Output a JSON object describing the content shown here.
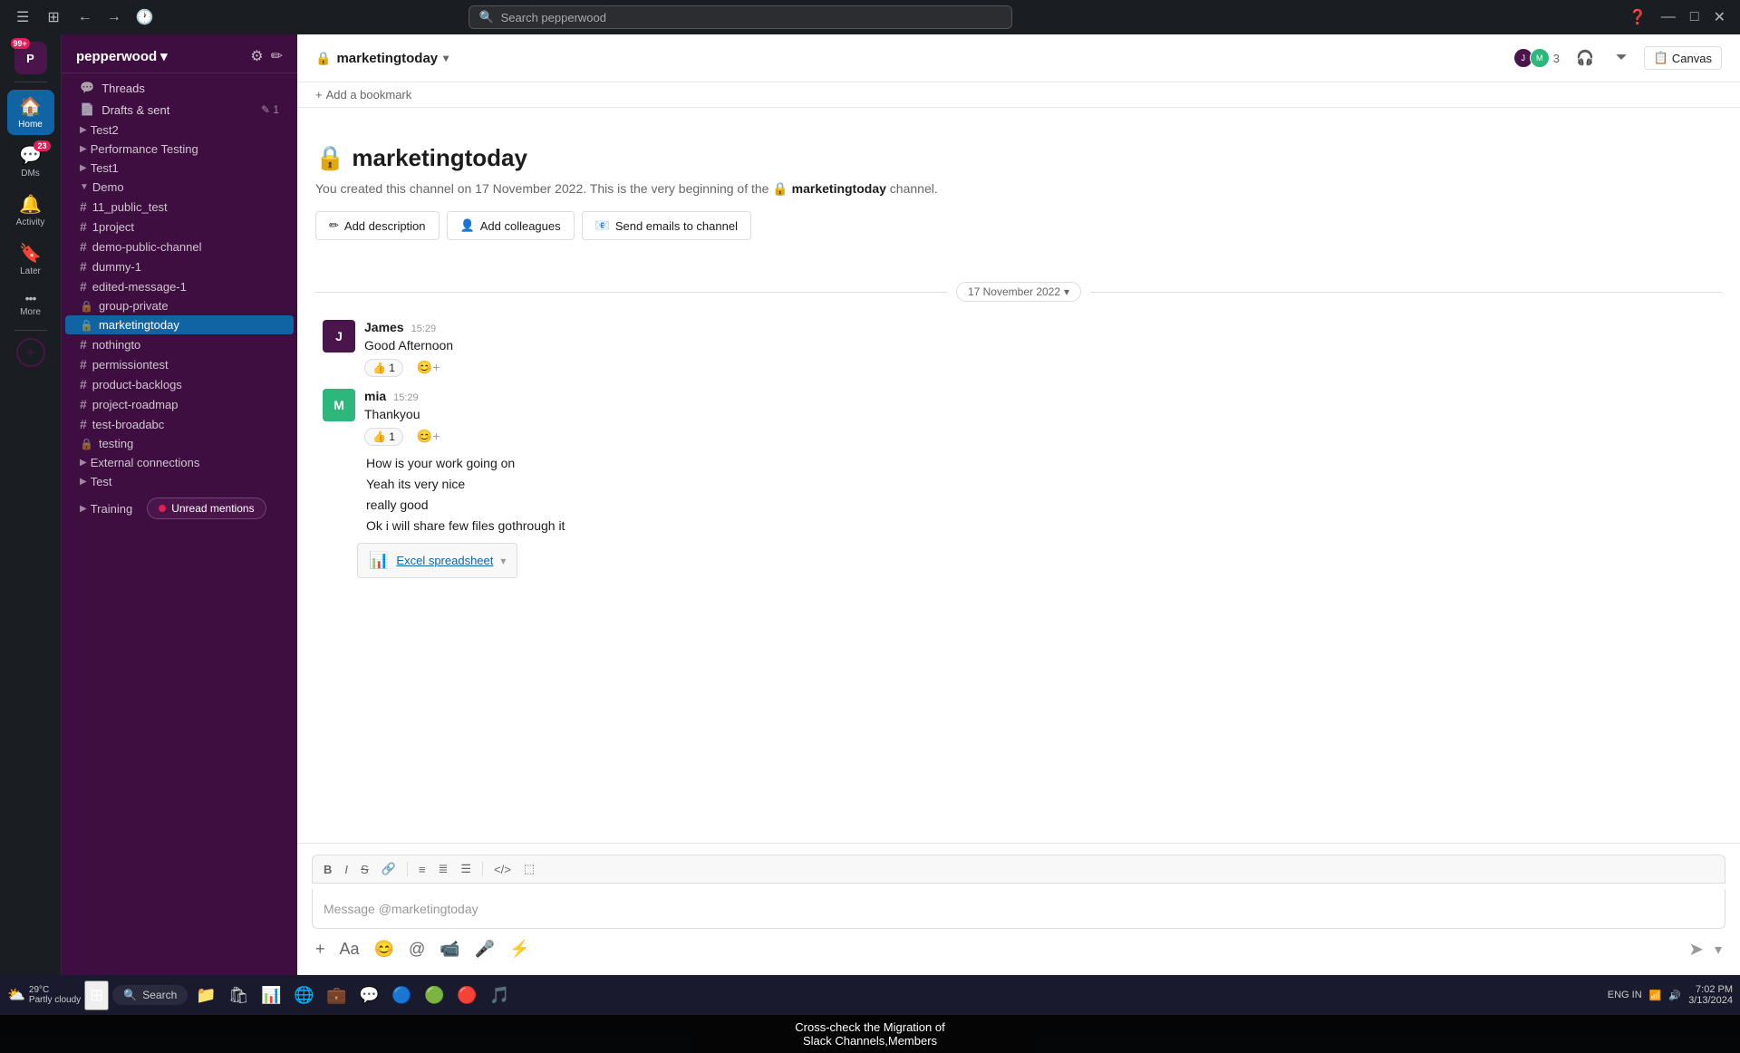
{
  "titlebar": {
    "search_placeholder": "Search pepperwood",
    "window_controls": {
      "minimize": "—",
      "maximize": "□",
      "close": "✕"
    }
  },
  "sidebar": {
    "workspace": "pepperwood",
    "items": [
      {
        "id": "threads",
        "label": "Threads",
        "icon": "💬",
        "type": "nav"
      },
      {
        "id": "drafts",
        "label": "Drafts & sent",
        "icon": "📄",
        "badge": "1",
        "type": "nav"
      },
      {
        "id": "test2",
        "label": "Test2",
        "type": "channel-group",
        "chevron": "▶"
      },
      {
        "id": "performance-testing",
        "label": "Performance Testing",
        "type": "channel-group",
        "chevron": "▶"
      },
      {
        "id": "test1",
        "label": "Test1",
        "type": "channel-group",
        "chevron": "▶"
      },
      {
        "id": "demo",
        "label": "Demo",
        "type": "channel-group",
        "chevron": "▼"
      },
      {
        "id": "11_public_test",
        "label": "11_public_test",
        "type": "public-channel"
      },
      {
        "id": "1project",
        "label": "1project",
        "type": "public-channel"
      },
      {
        "id": "demo-public-channel",
        "label": "demo-public-channel",
        "type": "public-channel"
      },
      {
        "id": "dummy-1",
        "label": "dummy-1",
        "type": "public-channel"
      },
      {
        "id": "edited-message-1",
        "label": "edited-message-1",
        "type": "public-channel"
      },
      {
        "id": "group-private",
        "label": "group-private",
        "type": "private-channel"
      },
      {
        "id": "marketingtoday",
        "label": "marketingtoday",
        "type": "private-channel",
        "active": true
      },
      {
        "id": "nothingto",
        "label": "nothingto",
        "type": "public-channel"
      },
      {
        "id": "permissiontest",
        "label": "permissiontest",
        "type": "public-channel"
      },
      {
        "id": "product-backlogs",
        "label": "product-backlogs",
        "type": "public-channel"
      },
      {
        "id": "project-roadmap",
        "label": "project-roadmap",
        "type": "public-channel"
      },
      {
        "id": "test-broadabc",
        "label": "test-broadabc",
        "type": "public-channel"
      },
      {
        "id": "testing",
        "label": "testing",
        "type": "private-channel"
      },
      {
        "id": "external-connections",
        "label": "External connections",
        "type": "channel-group",
        "chevron": "▶"
      },
      {
        "id": "test-group",
        "label": "Test",
        "type": "channel-group",
        "chevron": "▶"
      },
      {
        "id": "training",
        "label": "Training",
        "type": "channel-group",
        "chevron": "▶"
      }
    ],
    "unread_mentions_label": "Unread mentions"
  },
  "iconbar": {
    "items": [
      {
        "id": "home",
        "icon": "🏠",
        "label": "Home",
        "active": true
      },
      {
        "id": "dms",
        "icon": "💬",
        "label": "DMs",
        "badge": "23"
      },
      {
        "id": "activity",
        "icon": "🔔",
        "label": "Activity"
      },
      {
        "id": "later",
        "icon": "🔖",
        "label": "Later"
      },
      {
        "id": "more",
        "icon": "•••",
        "label": "More"
      }
    ],
    "avatar_text": "P",
    "avatar_badge": "99+"
  },
  "chat": {
    "channel_name": "marketingtoday",
    "member_count": "3",
    "canvas_label": "Canvas",
    "add_bookmark_label": "+ Add a bookmark",
    "intro": {
      "title": "🔒 marketingtoday",
      "description": "You created this channel on 17 November 2022. This is the very beginning of the",
      "channel_ref": "🔒 marketingtoday",
      "description_end": "channel.",
      "add_description_label": "Add description",
      "add_colleagues_label": "Add colleagues",
      "send_emails_label": "Send emails to channel"
    },
    "date_divider": "17 November 2022",
    "messages": [
      {
        "id": "msg1",
        "author": "James",
        "time": "15:29",
        "avatar_text": "J",
        "text": "Good Afternoon",
        "reactions": [
          {
            "emoji": "👍",
            "count": "1"
          }
        ]
      },
      {
        "id": "msg2",
        "author": "mia",
        "time": "15:29",
        "avatar_text": "M",
        "text": "Thankyou",
        "reactions": [
          {
            "emoji": "👍",
            "count": "1"
          }
        ],
        "continuations": [
          "How is your work going on",
          "Yeah its very nice",
          "really good",
          "Ok i will share few files gothrough it"
        ],
        "file": {
          "name": "Excel spreadsheet",
          "icon": "📊"
        }
      }
    ],
    "composer": {
      "placeholder": "Message @marketingtoday",
      "toolbar_items": [
        "B",
        "I",
        "S",
        "🔗",
        "≡",
        "≣",
        "☰",
        "</>",
        "⬚"
      ]
    }
  },
  "taskbar": {
    "weather": "29°C",
    "weather_desc": "Partly cloudy",
    "search_label": "Search",
    "time": "7:02 PM",
    "date": "3/13/2024",
    "lang": "ENG IN"
  },
  "bottom_banner": {
    "line1": "Cross-check the Migration of",
    "line2": "Slack Channels,Members"
  }
}
